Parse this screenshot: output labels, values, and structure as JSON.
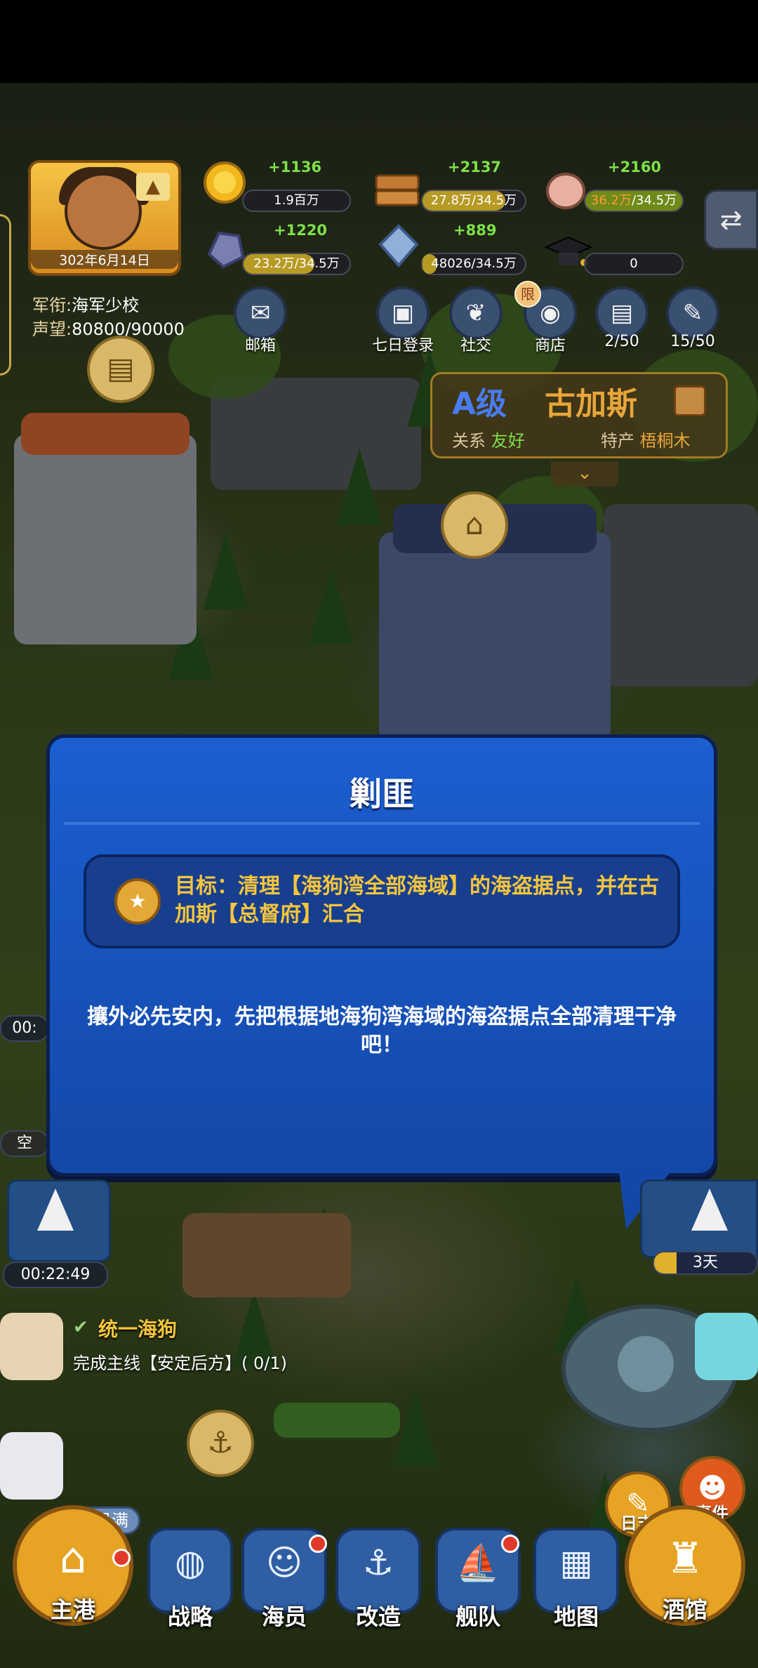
{
  "player": {
    "date": "302年6月14日",
    "rank_label": "军衔:",
    "rank_value": "海军少校",
    "fame_label": "声望:",
    "fame_value": "80800/90000"
  },
  "resources": {
    "gold": {
      "gain": "+1136",
      "amount": "1.9百万",
      "fill": 1.0
    },
    "wood": {
      "gain": "+2137",
      "amount": "27.8万/34.5万",
      "fill": 0.81
    },
    "meat": {
      "gain": "+2160",
      "amount_over": "36.2万",
      "amount_cap": "/34.5万",
      "fill": 1.0
    },
    "stone": {
      "gain": "+1220",
      "amount": "23.2万/34.5万",
      "fill": 0.67
    },
    "crystal": {
      "gain": "+889",
      "amount": "48026/34.5万",
      "fill": 0.14
    },
    "cap": {
      "amount": "0",
      "fill": 0.0
    }
  },
  "menu": {
    "mail": "邮箱",
    "login": "七日登录",
    "social": "社交",
    "shop": "商店",
    "shop_badge": "限",
    "book_count": "2/50",
    "quest_count": "15/50"
  },
  "city": {
    "grade": "A级",
    "name": "古加斯",
    "relation_label": "关系",
    "relation_value": "友好",
    "product_label": "特产",
    "product_value": "梧桐木"
  },
  "dialog": {
    "title": "剿匪",
    "goal": "目标：清理【海狗湾全部海域】的海盗据点，并在古加斯【总督府】汇合",
    "body": "攘外必先安内，先把根据地海狗湾海域的海盗据点全部清理干净吧！"
  },
  "timers": {
    "left_partial_1": "00:",
    "left_partial_2": "空",
    "ship_timer": "00:22:49",
    "voyage_days": "3天",
    "voyage_fill": 0.22
  },
  "quest": {
    "title": "统一海狗",
    "desc": "完成主线【安定后方】( 0/1)"
  },
  "harbor_status": "已满",
  "side": {
    "log": "日志",
    "event": "事件"
  },
  "nav": {
    "main": "主港",
    "strategy": "战略",
    "crew": "海员",
    "refit": "改造",
    "fleet": "舰队",
    "map": "地图",
    "tavern": "酒馆"
  },
  "colors": {
    "dialog_blue": "#1b5fd0",
    "goal_gold": "#f6c53c",
    "gain_green": "#7ee04a",
    "grade_blue": "#4a7cf0",
    "city_gold": "#e8a63a"
  },
  "icons": [
    "mail-icon",
    "calendar-icon",
    "laurel-icon",
    "shop-bag-icon",
    "book-icon",
    "quest-scroll-icon",
    "swap-icon",
    "gold-coin-icon",
    "wood-icon",
    "meat-icon",
    "stone-icon",
    "crystal-icon",
    "graduation-cap-icon",
    "goal-medal-icon"
  ]
}
